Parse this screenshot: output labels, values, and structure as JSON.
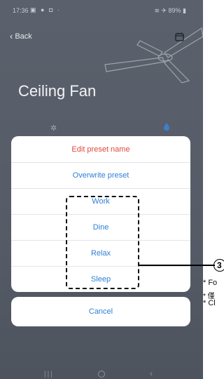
{
  "status_bar": {
    "time": "17:36",
    "left_icons": "▣ ● ◘ ·",
    "right_text": "≋ ✈ 89% ▮"
  },
  "header": {
    "back_label": "Back",
    "title": "Ceiling Fan"
  },
  "tabs": [
    {
      "icon": "fan-icon",
      "glyph": "✲"
    },
    {
      "icon": "droplet-icon"
    }
  ],
  "action_sheet": {
    "items": [
      {
        "label": "Edit preset name",
        "color": "#e0483e"
      },
      {
        "label": "Overwrite preset",
        "color": "#2f80d6"
      },
      {
        "label": "Work",
        "color": "#2f80d6"
      },
      {
        "label": "Dine",
        "color": "#2f80d6"
      },
      {
        "label": "Relax",
        "color": "#2f80d6"
      },
      {
        "label": "Sleep",
        "color": "#2f80d6"
      }
    ],
    "cancel_label": "Cancel"
  },
  "annotation": {
    "callout_number": "3",
    "notes": [
      "* Fo",
      "* 僅",
      "* Cl"
    ]
  },
  "colors": {
    "accent_blue": "#2f80d6",
    "destructive_red": "#e0483e",
    "overlay": "#565c67"
  }
}
